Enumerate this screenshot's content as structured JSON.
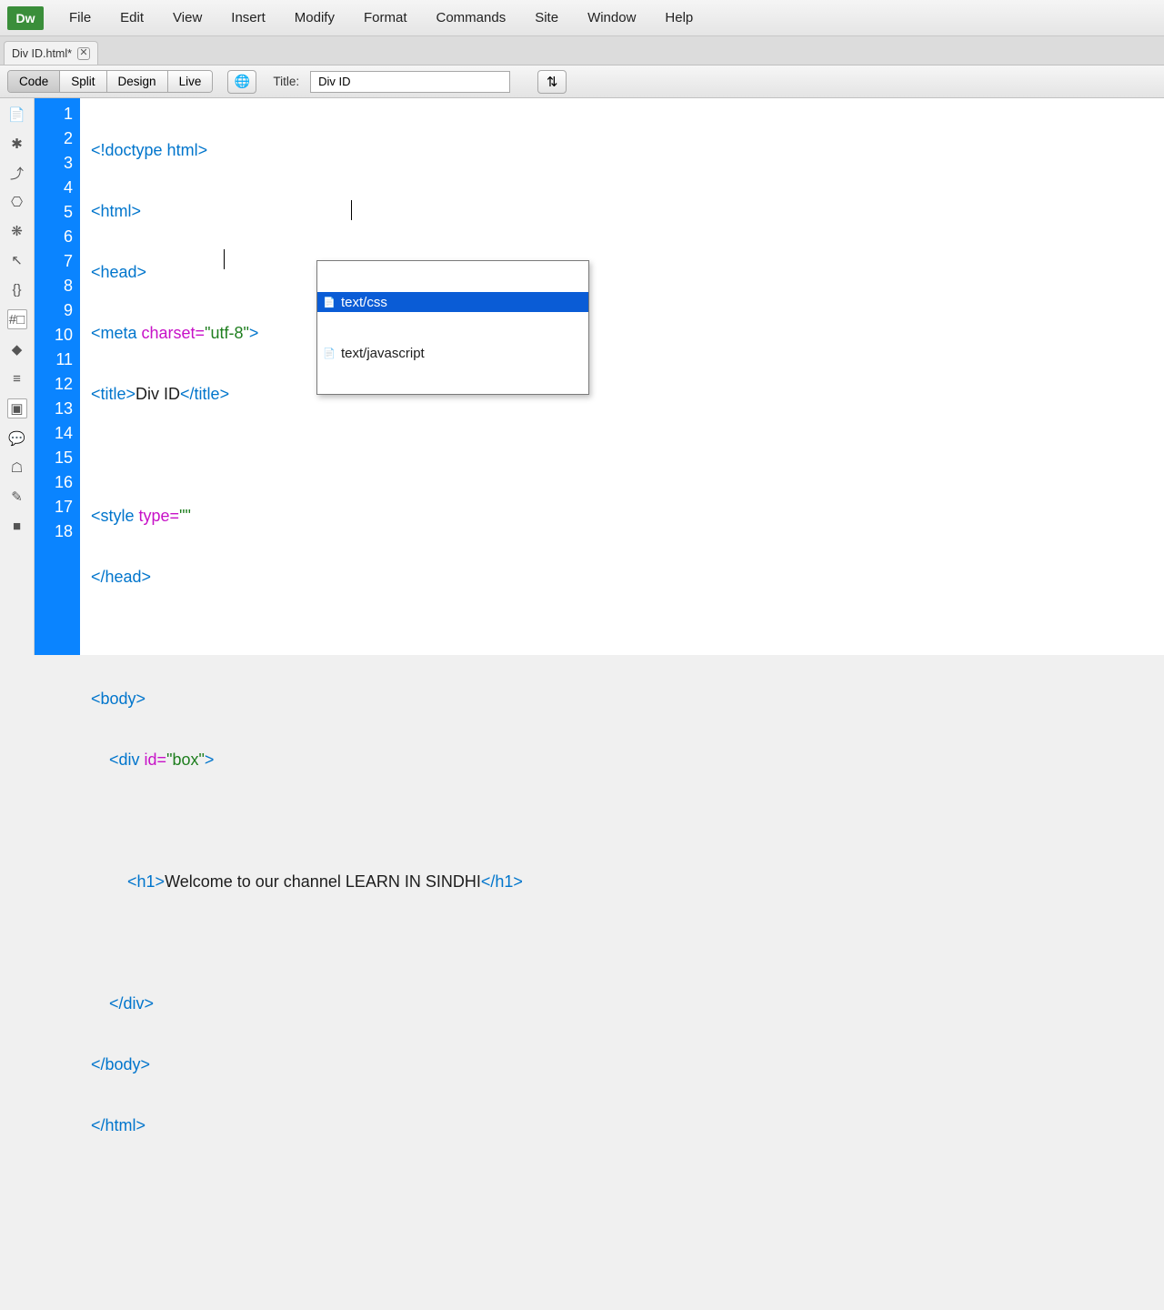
{
  "logo": "Dw",
  "menu": [
    "File",
    "Edit",
    "View",
    "Insert",
    "Modify",
    "Format",
    "Commands",
    "Site",
    "Window",
    "Help"
  ],
  "tab": {
    "label": "Div ID.html*",
    "close": "✕"
  },
  "toolbar": {
    "views": [
      "Code",
      "Split",
      "Design",
      "Live"
    ],
    "title_label": "Title:",
    "title_value": "Div ID",
    "globe": "🌐",
    "swap": "⇅"
  },
  "sidebar_icons": [
    "📄",
    "✱",
    "⤴",
    "⎔",
    "❋",
    "↖",
    "{}",
    "#□",
    "◆",
    "≡",
    "▣",
    "💬",
    "☖",
    "✎",
    "■"
  ],
  "line_numbers": [
    "1",
    "2",
    "3",
    "4",
    "5",
    "6",
    "7",
    "8",
    "9",
    "10",
    "11",
    "12",
    "13",
    "14",
    "15",
    "16",
    "17",
    "18"
  ],
  "autocomplete": {
    "items": [
      "text/css",
      "text/javascript"
    ],
    "selected_index": 0
  },
  "code": {
    "l1_a": "<!doctype html>",
    "l2_a": "<html>",
    "l3_a": "<head>",
    "l4_a": "<meta ",
    "l4_b": "charset=",
    "l4_c": "\"utf-8\"",
    "l4_d": ">",
    "l5_a": "<title>",
    "l5_b": "Div ID",
    "l5_c": "</title>",
    "l7_a": "<style ",
    "l7_b": "type=",
    "l7_c": "\"",
    "l7_d": "\"",
    "l8_a": "</head>",
    "l10_a": "<body>",
    "l11_a": "    <div ",
    "l11_b": "id=",
    "l11_c": "\"box\"",
    "l11_d": ">",
    "l13_a": "        <h1>",
    "l13_b": "Welcome to our channel LEARN IN SINDHI",
    "l13_c": "</h1>",
    "l15_a": "    </div>",
    "l16_a": "</body>",
    "l17_a": "</html>"
  }
}
